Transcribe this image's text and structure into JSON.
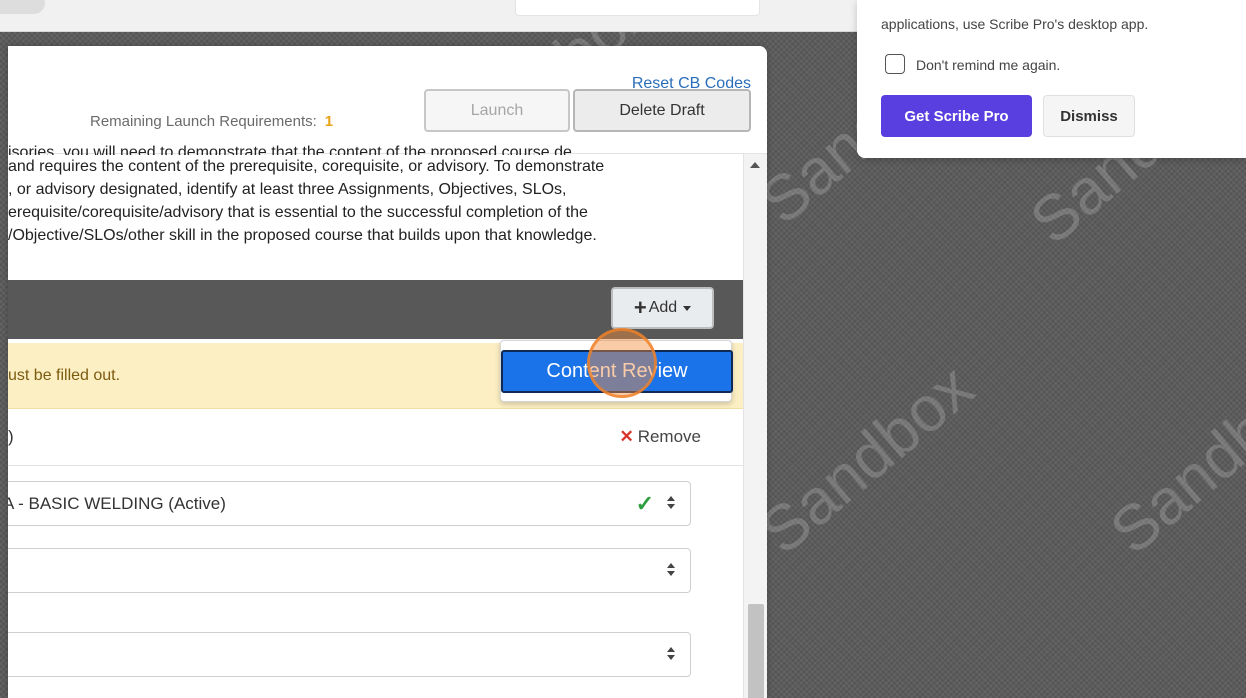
{
  "header": {
    "reset_link": "Reset CB Codes",
    "remaining_label": "Remaining Launch Requirements:",
    "remaining_count": "1",
    "launch_label": "Launch",
    "delete_label": "Delete Draft"
  },
  "body_text": {
    "line0": "isories, you will need to demonstrate that the content of the proposed course de",
    "line1": "and requires the content of the prerequisite, corequisite, or advisory. To demonstrate",
    "line2": ", or advisory designated, identify at least three Assignments, Objectives, SLOs,",
    "line3": "erequisite/corequisite/advisory that is essential to the successful completion of the",
    "line4": "/Objective/SLOs/other skill in the proposed course that builds upon that knowledge."
  },
  "add_button": {
    "label": "Add"
  },
  "dropdown": {
    "item": "Content Review"
  },
  "warning": {
    "text": "ust be filled out."
  },
  "requisite_row": {
    "heading": ")",
    "remove_label": "Remove"
  },
  "selects": {
    "course_value": "A - BASIC WELDING (Active)",
    "second_value": "",
    "third_value": ""
  },
  "notification": {
    "text": "applications, use Scribe Pro's desktop app.",
    "checkbox_label": "Don't remind me again.",
    "pro_label": "Get Scribe Pro",
    "dismiss_label": "Dismiss"
  },
  "watermark": "Sandbox"
}
